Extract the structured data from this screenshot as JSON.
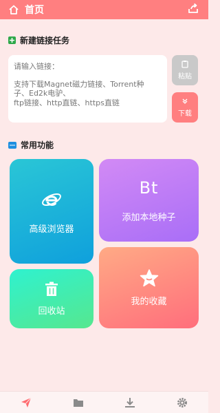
{
  "header": {
    "title": "首页"
  },
  "new_task": {
    "section_title": "新建链接任务",
    "placeholder": "请输入链接：",
    "hint_lines": [
      "支持下载Magnet磁力链接、Torrent种",
      "子、Ed2k电驴、",
      "ftp链接、http直链、https直链"
    ],
    "paste_label": "粘贴",
    "download_label": "下载"
  },
  "common": {
    "section_title": "常用功能",
    "cards": {
      "browser": "高级浏览器",
      "torrent_icon_text": "Bt",
      "torrent": "添加本地种子",
      "trash": "回收站",
      "favorites": "我的收藏"
    }
  },
  "colors": {
    "accent": "#ff7f80",
    "background": "#fde9e9"
  },
  "bottom_nav": [
    "send-icon",
    "folder-icon",
    "download-icon",
    "settings-icon"
  ]
}
